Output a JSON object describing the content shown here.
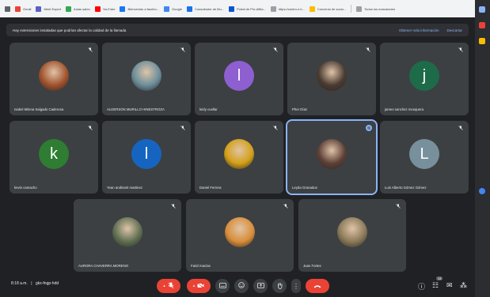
{
  "bookmarks": [
    {
      "label": "Gmail",
      "color": "#ea4335"
    },
    {
      "label": "Meet Expert",
      "color": "#5b5fc7"
    },
    {
      "label": "Aulas salón",
      "color": "#34a853"
    },
    {
      "label": "YouTube",
      "color": "#ff0000"
    },
    {
      "label": "Bienvenido a facebo...",
      "color": "#1877f2"
    },
    {
      "label": "Google",
      "color": "#4285f4"
    },
    {
      "label": "Consultador de Mu...",
      "color": "#1a73e8"
    },
    {
      "label": "Portal de Pre-Afilia...",
      "color": "#0b57d0"
    },
    {
      "label": "https://centro.e.b...",
      "color": "#9aa0a6"
    },
    {
      "label": "Convenio de socio...",
      "color": "#fbbc04"
    },
    {
      "label": "Todos los marcadores",
      "color": "#9aa0a6"
    }
  ],
  "banner": {
    "message": "Hay extensiones instaladas que podrían afectar la calidad de la llamada",
    "link_info": "Obtener más información",
    "link_close": "Descartar"
  },
  "participants": [
    {
      "name": "Isabel Milena Salgado Caderosa",
      "type": "photo",
      "initial": "",
      "color": "#a0522d"
    },
    {
      "name": "ALDERSON MURILLO HINESTROZA",
      "type": "photo",
      "initial": "",
      "color": "#6b8e9b"
    },
    {
      "name": "leidy cuellar",
      "type": "initial",
      "initial": "l",
      "color": "#8e5fd0"
    },
    {
      "name": "Pher Díaz",
      "type": "photo",
      "initial": "",
      "color": "#4a3b32"
    },
    {
      "name": "james sanchez mosquera",
      "type": "initial",
      "initial": "j",
      "color": "#1e6b4a"
    },
    {
      "name": "kevin camacho",
      "type": "initial",
      "initial": "k",
      "color": "#2e7d32"
    },
    {
      "name": "Yean andrianit martinez",
      "type": "initial",
      "initial": "l",
      "color": "#1565c0"
    },
    {
      "name": "Daniel Ferrera",
      "type": "photo",
      "initial": "",
      "color": "#d4a017"
    },
    {
      "name": "Leyda Granados",
      "type": "photo",
      "initial": "",
      "color": "#5d4037",
      "active": true
    },
    {
      "name": "Luis Alberto Gómez Gómez",
      "type": "initial",
      "initial": "L",
      "color": "#78909c"
    },
    {
      "name": "AURORA CHAVERRA MORENO",
      "type": "photo",
      "initial": "",
      "color": "#5f6f52"
    },
    {
      "name": "Farid macías",
      "type": "photo",
      "initial": "",
      "color": "#d98e3a"
    },
    {
      "name": "Juan Fortes",
      "type": "photo",
      "initial": "",
      "color": "#8a7a5a"
    }
  ],
  "bottom": {
    "time": "8:18 a.m.",
    "separator": "|",
    "meeting_code": "gkx-fngp-hdd",
    "participant_count": "13"
  },
  "icons": {
    "mic": "mic-icon",
    "camera": "camera-icon",
    "captions": "captions-icon",
    "emoji": "emoji-icon",
    "present": "present-icon",
    "hand": "raise-hand-icon",
    "more": "more-options-icon",
    "hangup": "hang-up-icon"
  }
}
